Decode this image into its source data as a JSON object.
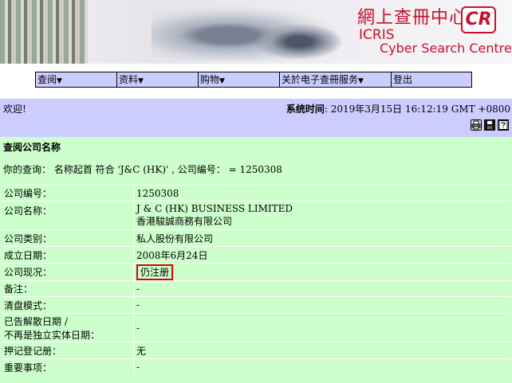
{
  "banner": {
    "title_cn": "網上查冊中心",
    "badge": "CR",
    "name_en_1": "ICRIS",
    "name_en_2": "Cyber Search Centre"
  },
  "menu": {
    "items": [
      {
        "label": "查阅",
        "arrow": "▼"
      },
      {
        "label": "资料",
        "arrow": "▼"
      },
      {
        "label": "购物",
        "arrow": "▼"
      },
      {
        "label": "关於电子查冊服务",
        "arrow": "▼"
      },
      {
        "label": "登出",
        "arrow": ""
      }
    ]
  },
  "welcome": {
    "greeting": "欢迎!",
    "systime_label": "系统时间",
    "systime_value": ": 2019年3月15日 16:12:19 GMT +0800"
  },
  "icons": [
    "printer-icon",
    "save-icon",
    "help-icon"
  ],
  "content": {
    "section_title": "查阅公司名称",
    "query": "你的查询： 名称起首 符合 'J&C (HK)' , 公司编号： = 1250308",
    "rows": [
      {
        "label": "公司编号：",
        "value": "1250308"
      },
      {
        "label": "公司名称：",
        "value": "J & C (HK) BUSINESS LIMITED",
        "value2": "香港駿誠商務有限公司"
      },
      {
        "label": "公司类别：",
        "value": "私人股份有限公司"
      },
      {
        "label": "成立日期：",
        "value": "2008年6月24日"
      },
      {
        "label": "公司现况：",
        "value": "仍注册"
      },
      {
        "label": "备注：",
        "value": "-"
      },
      {
        "label": "清盘模式：",
        "value": "-"
      },
      {
        "label": "已告解散日期 /",
        "label2": "不再是独立实体日期：",
        "value": "-"
      },
      {
        "label": "押记登记册：",
        "value": "无"
      },
      {
        "label": "重要事项：",
        "value": "-"
      }
    ]
  },
  "colors": {
    "menu_bg": "#ccccff",
    "content_bg": "#ccffcc",
    "brand_red": "#c8102e",
    "highlight_red": "#e00000"
  }
}
